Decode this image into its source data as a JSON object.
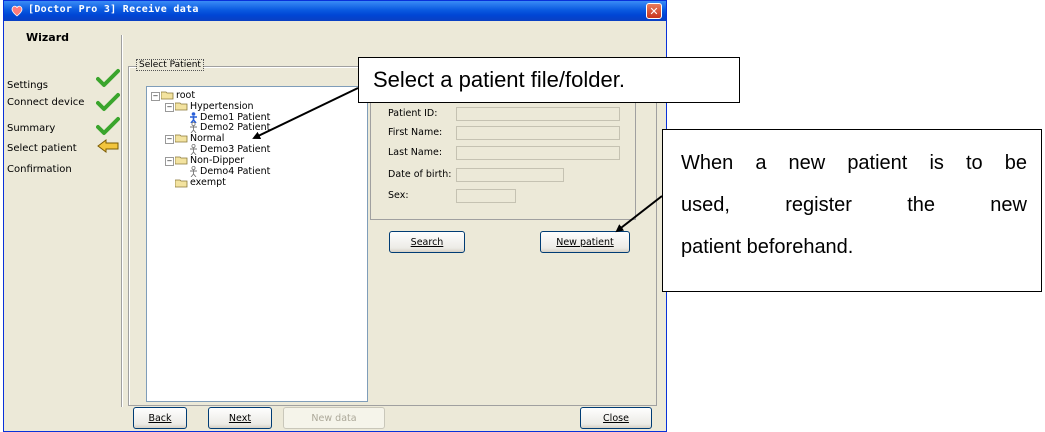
{
  "window": {
    "title": "[Doctor Pro 3] Receive data",
    "close_glyph": "✕"
  },
  "sidebar": {
    "title": "Wizard",
    "steps": [
      {
        "label": "Settings",
        "status": "done"
      },
      {
        "label": "Connect device",
        "status": "done"
      },
      {
        "label": "Summary",
        "status": "done"
      },
      {
        "label": "Select patient",
        "status": "current"
      },
      {
        "label": "Confirmation",
        "status": "pending"
      }
    ]
  },
  "select_patient": {
    "group_label": "Select Patient",
    "tree": {
      "root": "root",
      "hypertension": "Hypertension",
      "demo1": "Demo1 Patient",
      "demo2": "Demo2 Patient",
      "normal": "Normal",
      "demo3": "Demo3 Patient",
      "nondipper": "Non-Dipper",
      "demo4": "Demo4 Patient",
      "exempt": "exempt"
    },
    "fields": {
      "patient_id": "Patient ID:",
      "first_name": "First Name:",
      "last_name": "Last Name:",
      "dob": "Date of birth:",
      "sex": "Sex:"
    },
    "search_button": "Search",
    "new_patient_button": "New patient"
  },
  "footer": {
    "back": "Back",
    "next": "Next",
    "new_data": "New data",
    "close": "Close"
  },
  "callouts": {
    "select_hint": "Select a patient file/folder.",
    "register_hint": {
      "line1": [
        "When",
        "a",
        "new",
        "patient",
        "is",
        "to",
        "be"
      ],
      "line2": [
        "used,",
        "register",
        "the",
        "new"
      ],
      "line3": "patient beforehand."
    }
  },
  "colors": {
    "title_bar": "#0a5ae0",
    "check": "#3aa52c",
    "current_arrow": "#f2c53d"
  }
}
